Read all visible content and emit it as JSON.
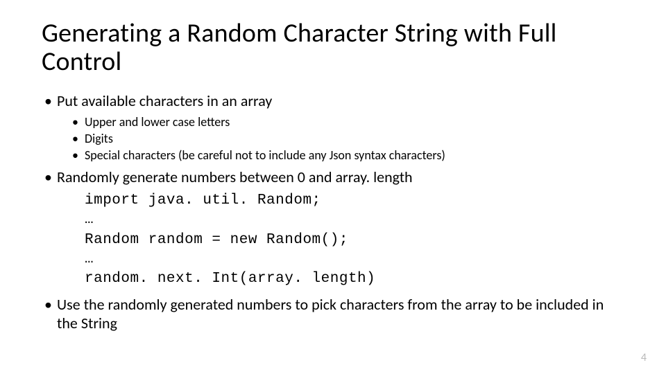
{
  "title": "Generating a Random Character String with Full Control",
  "bullets": {
    "b1": "Put available characters in an array",
    "b1_sub": {
      "s1": "Upper and lower case letters",
      "s2": "Digits",
      "s3": "Special characters (be careful not to include any Json syntax characters)"
    },
    "b2": "Randomly generate numbers between 0 and array. length",
    "code": {
      "l1": "import java. util. Random;",
      "l2": "…",
      "l3": "Random random = new Random();",
      "l4": "…",
      "l5": "random. next. Int(array. length)"
    },
    "b3": "Use the randomly generated numbers to pick characters from the array to be included in the String"
  },
  "page_number": "4"
}
